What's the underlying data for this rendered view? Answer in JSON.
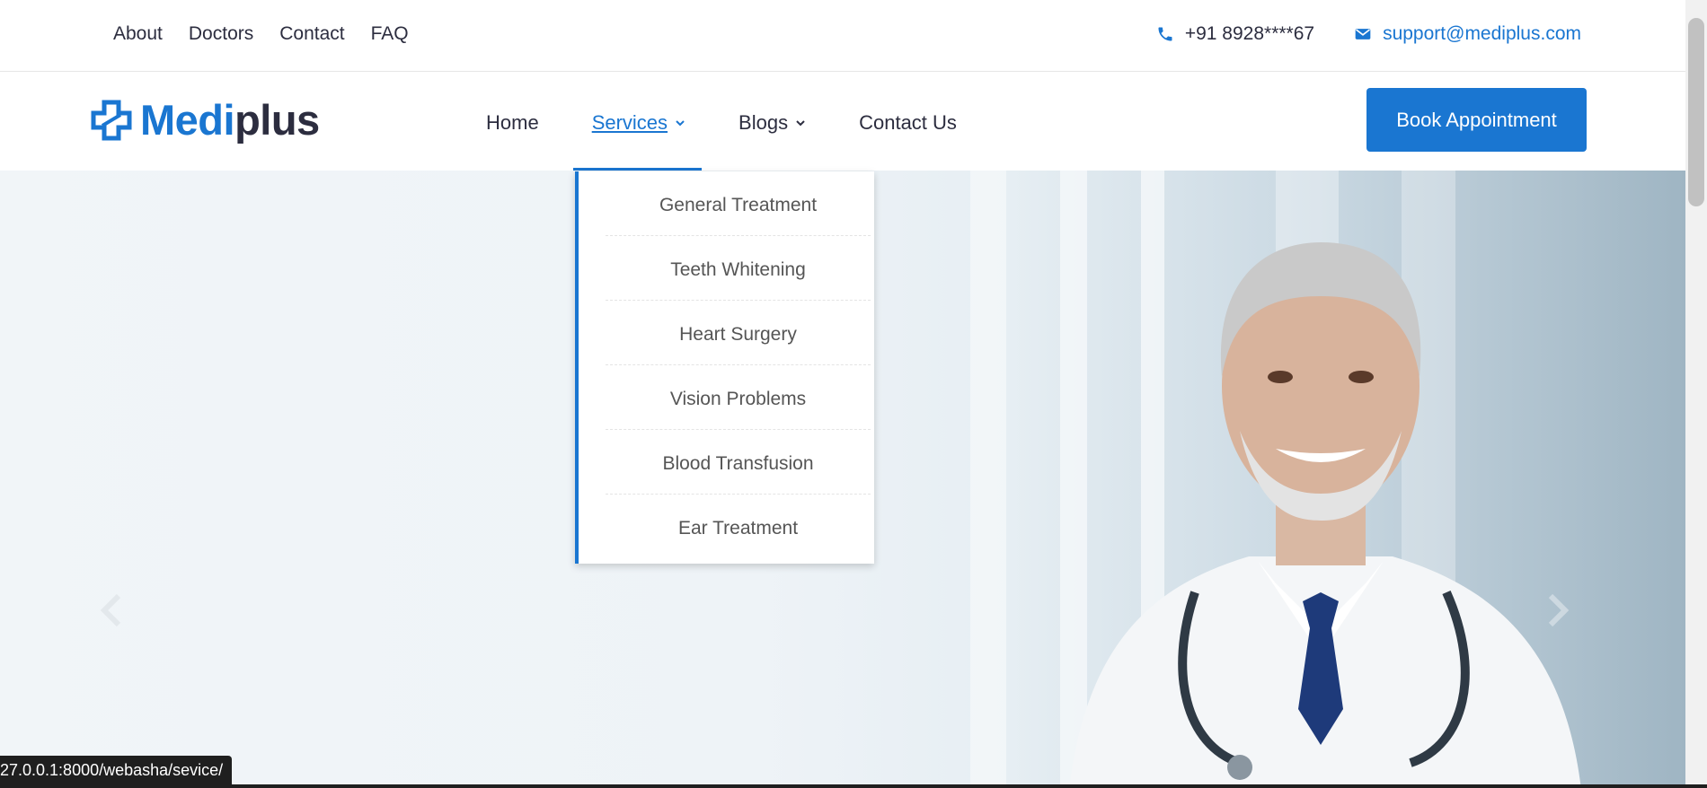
{
  "topbar": {
    "links": [
      "About",
      "Doctors",
      "Contact",
      "FAQ"
    ],
    "phone": "+91 8928****67",
    "email": "support@mediplus.com"
  },
  "brand": {
    "name_part1": "Medi",
    "name_part2": "plus"
  },
  "nav": {
    "home": "Home",
    "services": "Services",
    "blogs": "Blogs",
    "contact_us": "Contact Us",
    "book_button": "Book Appointment"
  },
  "services_menu": [
    "General Treatment",
    "Teeth Whitening",
    "Heart Surgery",
    "Vision Problems",
    "Blood Transfusion",
    "Ear Treatment"
  ],
  "status_url": "27.0.0.1:8000/webasha/sevice/",
  "colors": {
    "accent": "#1a76d1",
    "text": "#2c2d3f"
  },
  "icons": [
    "phone-icon",
    "envelope-icon",
    "chevron-down-icon",
    "chevron-left-icon",
    "chevron-right-icon"
  ]
}
